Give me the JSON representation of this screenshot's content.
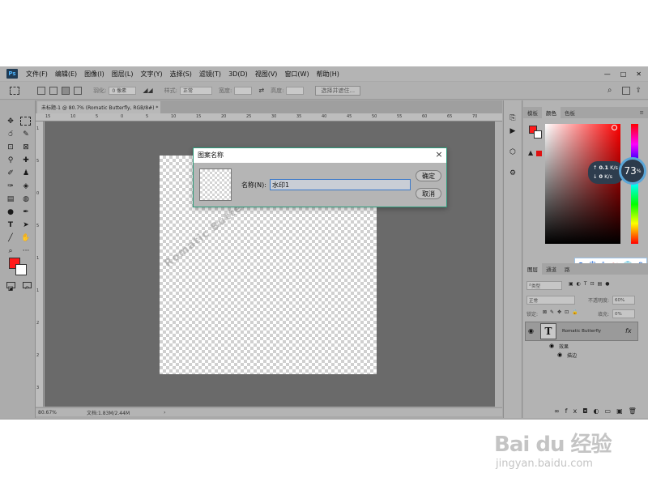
{
  "app": {
    "logo": "Ps"
  },
  "menu": [
    "文件(F)",
    "编辑(E)",
    "图像(I)",
    "图层(L)",
    "文字(Y)",
    "选择(S)",
    "滤镜(T)",
    "3D(D)",
    "视图(V)",
    "窗口(W)",
    "帮助(H)"
  ],
  "options": {
    "feather_label": "羽化:",
    "feather_value": "0 像素",
    "style_label": "样式:",
    "style_value": "正常",
    "width_label": "宽度:",
    "height_label": "高度:",
    "select_mask_button": "选择并遮住..."
  },
  "document": {
    "tab_title": "未标题-1 @ 80.7% (Romatic Butterfly, RGB/8#) *",
    "tab_close": "×",
    "watermark_text": "Romatic Butterfly",
    "zoom": "80.67%",
    "doc_size": "文档:1.83M/2.44M"
  },
  "ruler_ticks": [
    "15",
    "10",
    "5",
    "0",
    "5",
    "10",
    "15",
    "20",
    "25",
    "30",
    "35",
    "40",
    "45",
    "50",
    "55",
    "60",
    "65",
    "70"
  ],
  "colors": {
    "foreground": "#ff1a1a",
    "background": "#ffffff",
    "dialog_border": "#2f9d7c"
  },
  "color_panel": {
    "tabs": [
      "模板",
      "颜色",
      "色板"
    ],
    "active_tab": "颜色",
    "upload": "0.1",
    "upload_unit": "K/s",
    "download": "0",
    "download_unit": "K/s",
    "gauge": "73",
    "gauge_unit": "%"
  },
  "ime": {
    "lang": "中",
    "punct": "°,"
  },
  "layers_panel": {
    "tabs": [
      "图层",
      "通道",
      "路"
    ],
    "kind": "类型",
    "blend_mode": "正常",
    "opacity_label": "不透明度:",
    "opacity_value": "60%",
    "lock_label": "锁定:",
    "fill_label": "填充:",
    "fill_value": "0%",
    "layer_name": "Romatic Butterfly",
    "layer_thumb": "T",
    "fx": "fx",
    "effects_label": "效果",
    "stroke_label": "描边"
  },
  "dialog": {
    "title": "图案名称",
    "close": "×",
    "name_label": "名称(N):",
    "name_value": "水印1",
    "ok": "确定",
    "cancel": "取消"
  },
  "site_watermark": {
    "logo": "Bai du 经验",
    "url": "jingyan.baidu.com"
  }
}
